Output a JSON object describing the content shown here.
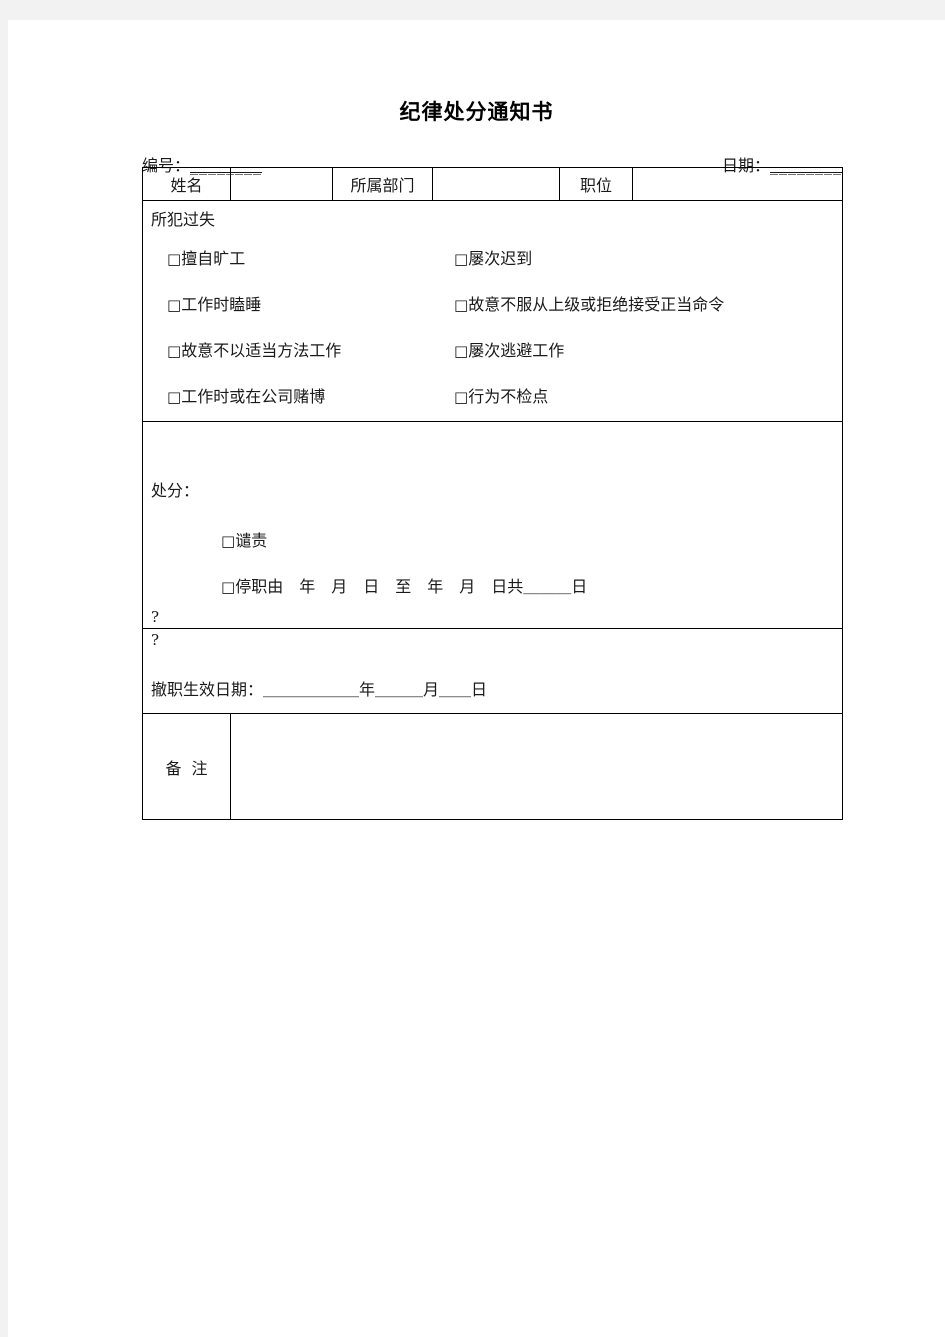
{
  "document": {
    "title": "纪律处分通知书",
    "meta": {
      "serial_label": "编号：",
      "serial_value": "________",
      "date_label": "日期：",
      "date_value": "________"
    },
    "info_row": {
      "name_label": "姓名",
      "name_value": "",
      "department_label": "所属部门",
      "department_value": "",
      "position_label": "职位",
      "position_value": ""
    },
    "offense": {
      "heading": "所犯过失",
      "checkbox_glyph": "□",
      "options_left": [
        "擅自旷工",
        "工作时瞌睡",
        "故意不以适当方法工作",
        "工作时或在公司赌博"
      ],
      "options_right": [
        "屡次迟到",
        "故意不服从上级或拒绝接受正当命令",
        "屡次逃避工作",
        "行为不检点"
      ]
    },
    "punishment": {
      "heading": "处分：",
      "option_reprimand": "谴责",
      "option_suspension": "停职由　年　月　日　至　年　月　日共＿＿＿日",
      "placeholder_mark": "?"
    },
    "dismissal": {
      "placeholder_mark": "?",
      "effective_date_line": "撤职生效日期：＿＿＿＿＿＿年＿＿＿月＿＿日"
    },
    "remarks": {
      "label": "备注",
      "value": ""
    }
  },
  "colors": {
    "page_background": "#ffffff",
    "canvas_background": "#f2f2f2",
    "text": "#1a1a1a",
    "border": "#000000"
  }
}
